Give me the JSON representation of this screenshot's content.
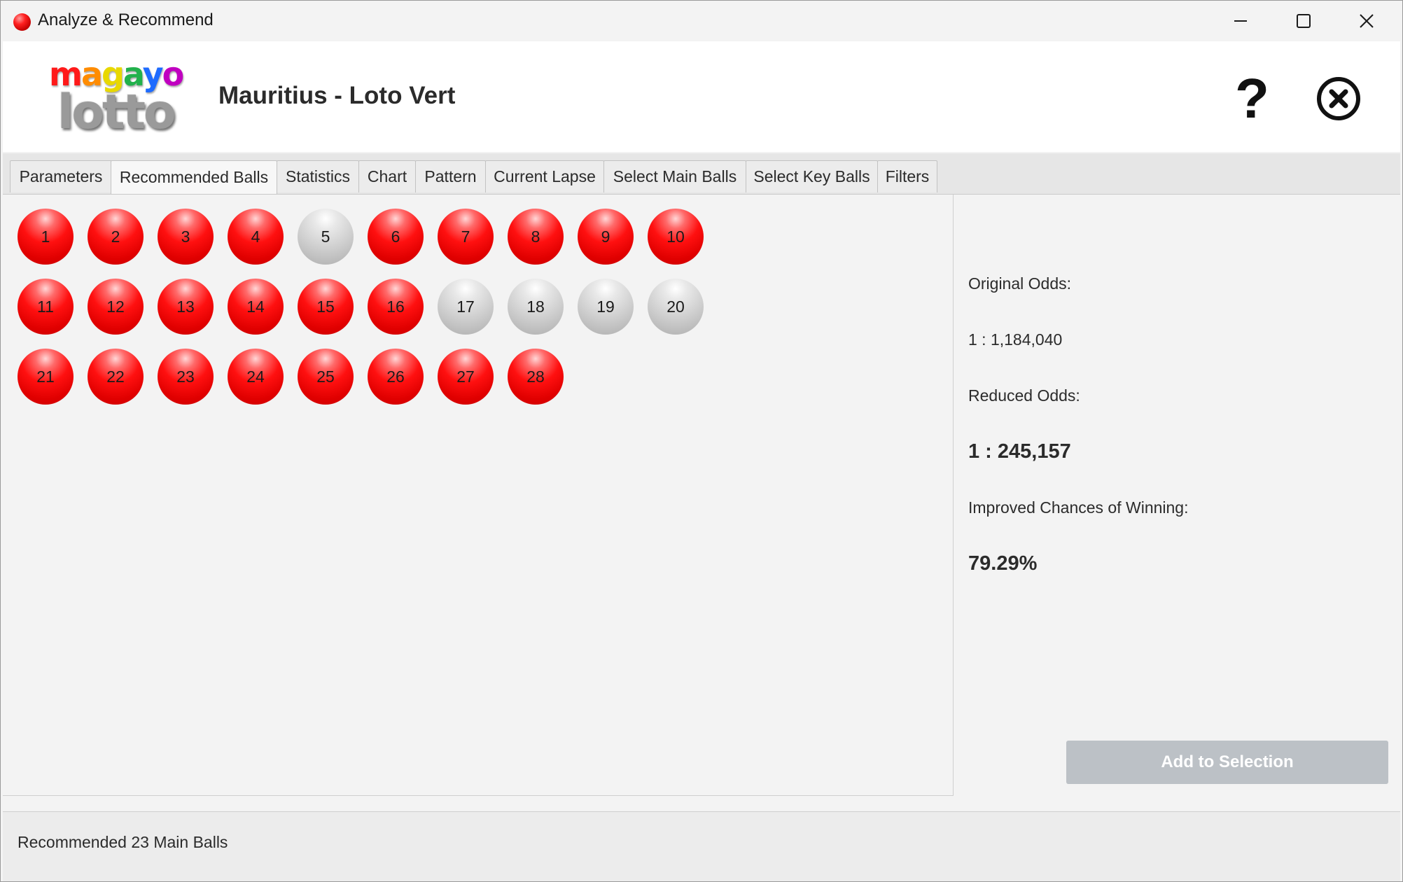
{
  "window": {
    "title": "Analyze & Recommend"
  },
  "header": {
    "logo_top": "magayo",
    "logo_bottom": "lotto",
    "lottery_name": "Mauritius - Loto Vert"
  },
  "tabs": [
    {
      "label": "Parameters"
    },
    {
      "label": "Recommended Balls"
    },
    {
      "label": "Statistics"
    },
    {
      "label": "Chart"
    },
    {
      "label": "Pattern"
    },
    {
      "label": "Current Lapse"
    },
    {
      "label": "Select Main Balls"
    },
    {
      "label": "Select Key Balls"
    },
    {
      "label": "Filters"
    }
  ],
  "active_tab": "Recommended Balls",
  "balls": [
    {
      "number": "1",
      "state": "recommended"
    },
    {
      "number": "2",
      "state": "recommended"
    },
    {
      "number": "3",
      "state": "recommended"
    },
    {
      "number": "4",
      "state": "recommended"
    },
    {
      "number": "5",
      "state": "not-recommended"
    },
    {
      "number": "6",
      "state": "recommended"
    },
    {
      "number": "7",
      "state": "recommended"
    },
    {
      "number": "8",
      "state": "recommended"
    },
    {
      "number": "9",
      "state": "recommended"
    },
    {
      "number": "10",
      "state": "recommended"
    },
    {
      "number": "11",
      "state": "recommended"
    },
    {
      "number": "12",
      "state": "recommended"
    },
    {
      "number": "13",
      "state": "recommended"
    },
    {
      "number": "14",
      "state": "recommended"
    },
    {
      "number": "15",
      "state": "recommended"
    },
    {
      "number": "16",
      "state": "recommended"
    },
    {
      "number": "17",
      "state": "not-recommended"
    },
    {
      "number": "18",
      "state": "not-recommended"
    },
    {
      "number": "19",
      "state": "not-recommended"
    },
    {
      "number": "20",
      "state": "not-recommended"
    },
    {
      "number": "21",
      "state": "recommended"
    },
    {
      "number": "22",
      "state": "recommended"
    },
    {
      "number": "23",
      "state": "recommended"
    },
    {
      "number": "24",
      "state": "recommended"
    },
    {
      "number": "25",
      "state": "recommended"
    },
    {
      "number": "26",
      "state": "recommended"
    },
    {
      "number": "27",
      "state": "recommended"
    },
    {
      "number": "28",
      "state": "recommended"
    }
  ],
  "info": {
    "original_odds_label": "Original Odds:",
    "original_odds_value": "1 : 1,184,040",
    "reduced_odds_label": "Reduced Odds:",
    "reduced_odds_value": "1 : 245,157",
    "improved_label": "Improved Chances of Winning:",
    "improved_value": "79.29%",
    "add_button_label": "Add to Selection"
  },
  "status": {
    "text": "Recommended 23 Main Balls"
  },
  "colors": {
    "recommended_ball": "#ff1010",
    "not_recommended_ball": "#cfcfcf",
    "disabled_button": "#bcc1c6"
  },
  "icons": {
    "app": "red-ball-icon",
    "minimize": "minimize-icon",
    "maximize": "maximize-icon",
    "close": "close-icon",
    "help": "question-mark-icon",
    "exit": "circle-x-icon"
  }
}
